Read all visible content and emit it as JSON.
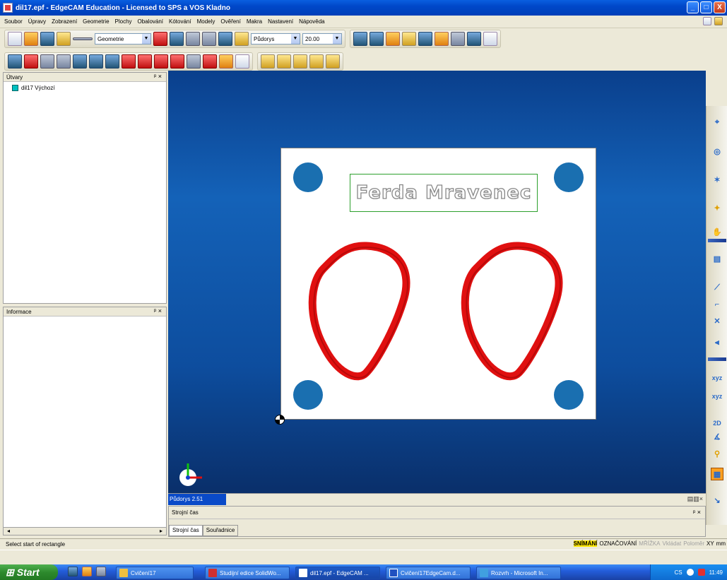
{
  "window": {
    "title": "dil17.epf - EdgeCAM Education - Licensed to SPS a VOS Kladno",
    "minimize": "_",
    "maximize": "□",
    "close": "X"
  },
  "menu": [
    "Soubor",
    "Úpravy",
    "Zobrazení",
    "Geometrie",
    "Plochy",
    "Obalování",
    "Kótování",
    "Modely",
    "Ověření",
    "Makra",
    "Nastavení",
    "Nápověda"
  ],
  "toolbar": {
    "layer_combo": "Geometrie",
    "view_combo": "Půdorys",
    "depth_combo": "20.00"
  },
  "panes": {
    "features_title": "Útvary",
    "tree_item": "dil17 Výchozí",
    "info_title": "Informace",
    "pin": "ᵖ ×"
  },
  "viewport": {
    "nameplate_text": "Ferda Mravenec",
    "view_label": "Půdorys 2.51"
  },
  "bottom_panel": {
    "title": "Strojní čas",
    "pin": "ᵖ ×",
    "tabs": [
      "Strojní čas",
      "Souřadnice"
    ]
  },
  "status": {
    "prompt": "Select start of rectangle",
    "modes": [
      {
        "label": "SNÍMÁNÍ",
        "state": "on"
      },
      {
        "label": "OZNAČOVÁNÍ",
        "state": "normal"
      },
      {
        "label": "MŘÍŽKA",
        "state": "off"
      },
      {
        "label": "Vkládat",
        "state": "off"
      },
      {
        "label": "Poloměr",
        "state": "off"
      },
      {
        "label": "XY",
        "state": "normal"
      },
      {
        "label": "mm",
        "state": "normal"
      }
    ]
  },
  "taskbar": {
    "start": "Start",
    "items": [
      "Cvičení17",
      "Studijní edice SolidWo...",
      "dil17.epf - EdgeCAM ...",
      "Cvičení17EdgeCam.d...",
      "Rozvrh - Microsoft In..."
    ],
    "lang": "CS",
    "clock": "11:49"
  },
  "right_toolbar": {
    "xyz1": "xyz",
    "xyz2": "xyz",
    "twod": "2D"
  }
}
